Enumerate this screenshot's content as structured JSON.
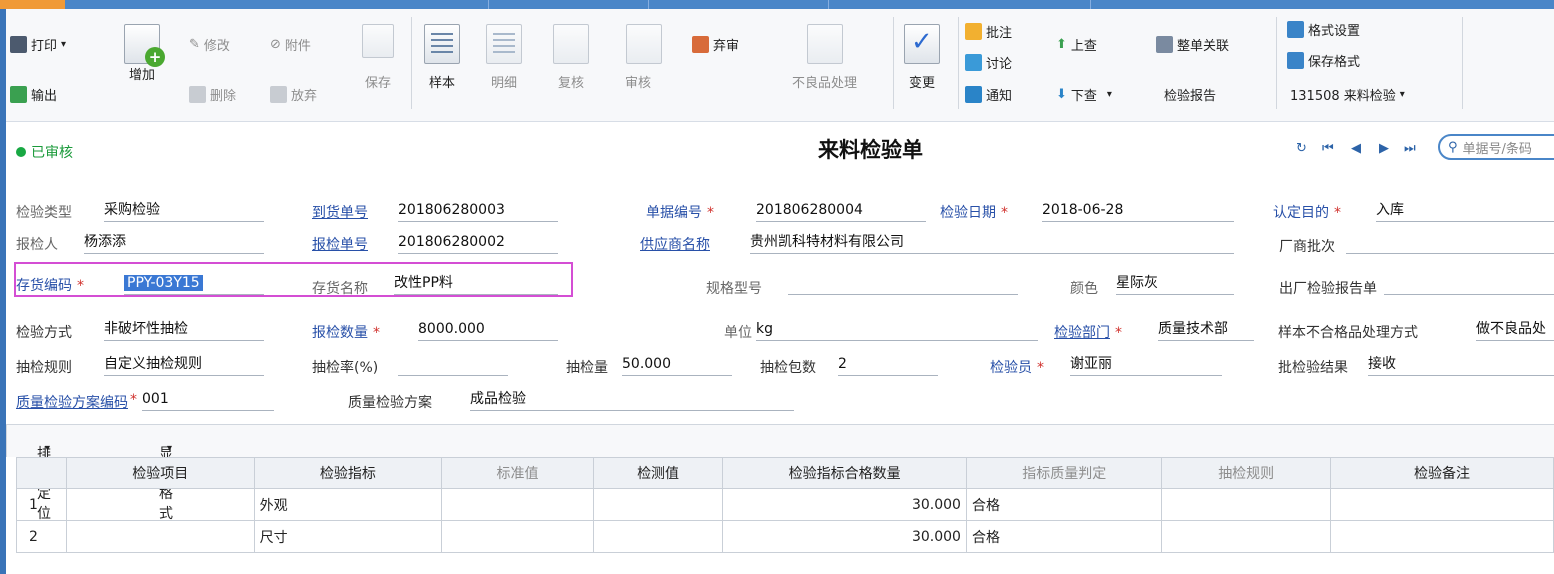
{
  "toolbar": {
    "print": "打印",
    "export": "输出",
    "add": "增加",
    "modify": "修改",
    "delete": "删除",
    "attachment": "附件",
    "abandon": "放弃",
    "save": "保存",
    "sample": "样本",
    "detail": "明细",
    "review": "复核",
    "audit": "审核",
    "unaudit": "弃审",
    "defect": "不良品处理",
    "change": "变更",
    "annotate": "批注",
    "discuss": "讨论",
    "notify": "通知",
    "up": "上查",
    "down": "下查",
    "related": "整单关联",
    "report": "检验报告",
    "format_setting": "格式设置",
    "save_format": "保存格式",
    "format_name": "131508 来料检验"
  },
  "header": {
    "status": "已审核",
    "title": "来料检验单",
    "search_placeholder": "单据号/条码"
  },
  "form": {
    "inspect_type_label": "检验类型",
    "inspect_type": "采购检验",
    "arrival_no_label": "到货单号",
    "arrival_no": "201806280003",
    "doc_no_label": "单据编号",
    "doc_no": "201806280004",
    "inspect_date_label": "检验日期",
    "inspect_date": "2018-06-28",
    "purpose_label": "认定目的",
    "purpose": "入库",
    "reporter_label": "报检人",
    "reporter": "杨添添",
    "report_no_label": "报检单号",
    "report_no": "201806280002",
    "supplier_label": "供应商名称",
    "supplier": "贵州凯科特材料有限公司",
    "batch_label": "厂商批次",
    "batch": "",
    "inv_code_label": "存货编码",
    "inv_code": "PPY-03Y15",
    "inv_name_label": "存货名称",
    "inv_name": "改性PP料",
    "spec_label": "规格型号",
    "spec": "",
    "color_label": "颜色",
    "color": "星际灰",
    "factory_report_label": "出厂检验报告单",
    "factory_report": "",
    "method_label": "检验方式",
    "method": "非破坏性抽检",
    "qty_label": "报检数量",
    "qty": "8000.000",
    "unit_label": "单位",
    "unit": "kg",
    "dept_label": "检验部门",
    "dept": "质量技术部",
    "nonconf_label": "样本不合格品处理方式",
    "nonconf": "做不良品处",
    "rule_label": "抽检规则",
    "rule": "自定义抽检规则",
    "rate_label": "抽检率(%)",
    "rate": "",
    "sample_qty_label": "抽检量",
    "sample_qty": "50.000",
    "packs_label": "抽检包数",
    "packs": "2",
    "inspector_label": "检验员",
    "inspector": "谢亚丽",
    "batch_result_label": "批检验结果",
    "batch_result": "接收",
    "plan_code_label": "质量检验方案编码",
    "plan_code": "001",
    "plan_label": "质量检验方案",
    "plan": "成品检验"
  },
  "grid": {
    "sort_label": "排序定位",
    "display_label": "显示格式",
    "columns": [
      "检验项目",
      "检验指标",
      "标准值",
      "检测值",
      "检验指标合格数量",
      "指标质量判定",
      "抽检规则",
      "检验备注"
    ],
    "rows": [
      {
        "no": "1",
        "item": "",
        "indicator": "外观",
        "standard": "",
        "measured": "",
        "qualified": "30.000",
        "judge": "合格",
        "rule": "",
        "remark": ""
      },
      {
        "no": "2",
        "item": "",
        "indicator": "尺寸",
        "standard": "",
        "measured": "",
        "qualified": "30.000",
        "judge": "合格",
        "rule": "",
        "remark": ""
      }
    ]
  }
}
